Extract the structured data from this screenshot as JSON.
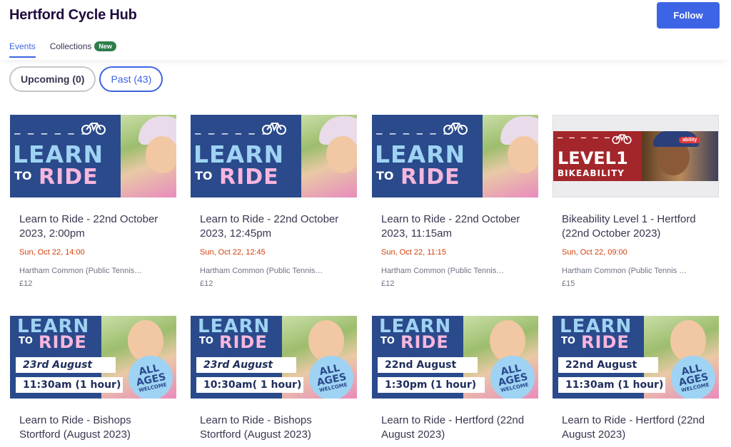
{
  "header": {
    "org_title": "Hertford Cycle Hub",
    "follow_label": "Follow",
    "tabs": [
      {
        "label": "Events",
        "active": true
      },
      {
        "label": "Collections",
        "badge": "New",
        "active": false
      }
    ]
  },
  "filters": [
    {
      "label": "Upcoming (0)",
      "active": false
    },
    {
      "label": "Past (43)",
      "active": true
    }
  ],
  "banner_text": {
    "learn": "LEARN",
    "to": "TO",
    "ride": "RIDE",
    "level1": "LEVEL1",
    "bikeability": "BIKEABILITY",
    "ages_all": "ALL",
    "ages_ages": "AGES",
    "ages_welcome": "WELCOME",
    "logo_word": "ability"
  },
  "events_row1": [
    {
      "title": "Learn to Ride - 22nd October 2023, 2:00pm",
      "date": "Sun, Oct 22, 14:00",
      "venue": "Hartham Common (Public Tennis…",
      "price": "£12",
      "banner": "learn"
    },
    {
      "title": "Learn to Ride - 22nd October 2023, 12:45pm",
      "date": "Sun, Oct 22, 12:45",
      "venue": "Hartham Common (Public Tennis…",
      "price": "£12",
      "banner": "learn"
    },
    {
      "title": "Learn to Ride - 22nd October 2023, 11:15am",
      "date": "Sun, Oct 22, 11:15",
      "venue": "Hartham Common (Public Tennis…",
      "price": "£12",
      "banner": "learn"
    },
    {
      "title": "Bikeability Level 1 - Hertford (22nd October 2023)",
      "date": "Sun, Oct 22, 09:00",
      "venue": "Hartham Common (Public Tennis Cour…",
      "price": "£15",
      "banner": "bikeability"
    }
  ],
  "events_row2": [
    {
      "title": "Learn to Ride - Bishops Stortford (August 2023)",
      "banner_date": "23rd August",
      "banner_time": "11:30am (1 hour)"
    },
    {
      "title": "Learn to Ride - Bishops Stortford (August 2023)",
      "banner_date": "23rd August",
      "banner_time": "10:30am( 1 hour)"
    },
    {
      "title": "Learn to Ride - Hertford (22nd August 2023)",
      "banner_date": "22nd August",
      "banner_time": "1:30pm  (1 hour)"
    },
    {
      "title": "Learn to Ride - Hertford (22nd August 2023)",
      "banner_date": "22nd August",
      "banner_time": "11:30am (1 hour)"
    }
  ],
  "colors": {
    "accent": "#3d64e5",
    "date_orange": "#d1410c",
    "badge_green": "#2f7d4b",
    "banner_blue": "#2a4a8c",
    "bikeability_red": "#a3262a"
  }
}
